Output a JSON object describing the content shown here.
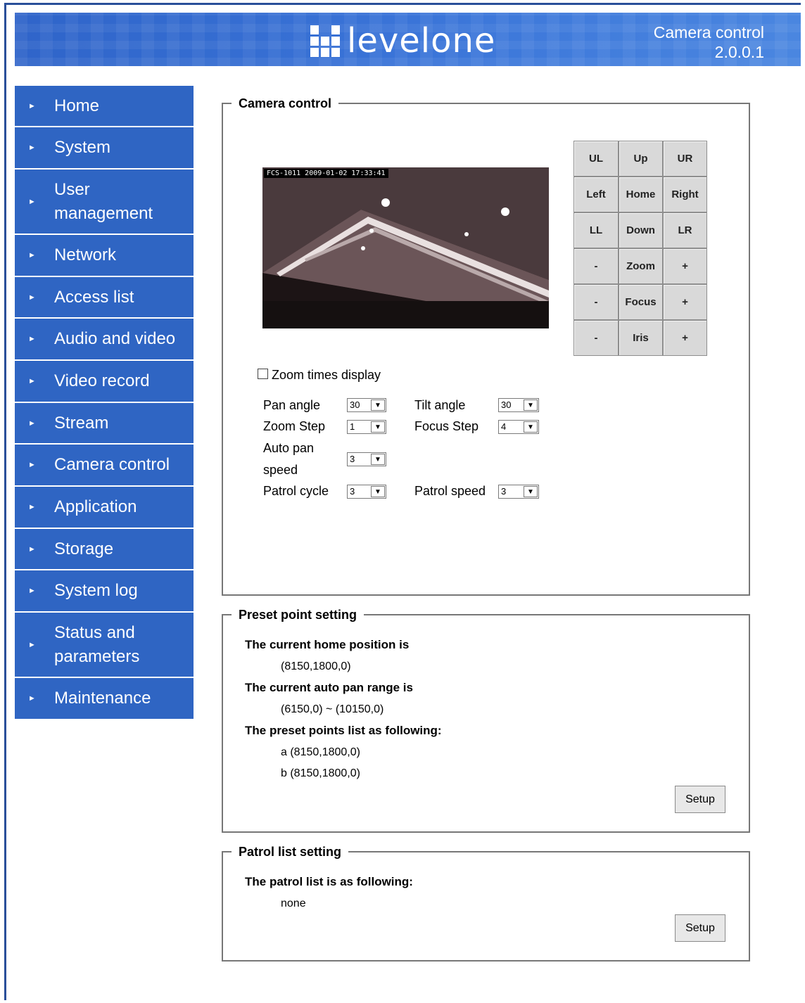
{
  "header": {
    "logo_text": "levelone",
    "page_title": "Camera control",
    "version": "2.0.0.1"
  },
  "sidebar": {
    "items": [
      {
        "label": "Home"
      },
      {
        "label": "System"
      },
      {
        "label": "User management"
      },
      {
        "label": "Network"
      },
      {
        "label": "Access list"
      },
      {
        "label": "Audio and video"
      },
      {
        "label": "Video record"
      },
      {
        "label": "Stream"
      },
      {
        "label": "Camera control"
      },
      {
        "label": "Application"
      },
      {
        "label": "Storage"
      },
      {
        "label": "System log"
      },
      {
        "label": "Status and parameters"
      },
      {
        "label": "Maintenance"
      }
    ],
    "bullet_icon": "triangle-right-icon"
  },
  "camera_control": {
    "legend": "Camera control",
    "video_timestamp": "FCS-1011 2009-01-02 17:33:41",
    "ptz": {
      "ul": "UL",
      "up": "Up",
      "ur": "UR",
      "left": "Left",
      "home": "Home",
      "right": "Right",
      "ll": "LL",
      "down": "Down",
      "lr": "LR",
      "zoom_minus": "-",
      "zoom": "Zoom",
      "zoom_plus": "+",
      "focus_minus": "-",
      "focus": "Focus",
      "focus_plus": "+",
      "iris_minus": "-",
      "iris": "Iris",
      "iris_plus": "+"
    },
    "zoom_times_display": "Zoom times display",
    "pan_angle_label": "Pan angle",
    "pan_angle_value": "30",
    "tilt_angle_label": "Tilt angle",
    "tilt_angle_value": "30",
    "zoom_step_label": "Zoom Step",
    "zoom_step_value": "1",
    "focus_step_label": "Focus Step",
    "focus_step_value": "4",
    "auto_pan_label_1": "Auto pan",
    "auto_pan_label_2": "speed",
    "auto_pan_value": "3",
    "patrol_cycle_label": "Patrol cycle",
    "patrol_cycle_value": "3",
    "patrol_speed_label": "Patrol speed",
    "patrol_speed_value": "3"
  },
  "preset": {
    "legend": "Preset point setting",
    "home_label": "The current home position is",
    "home_value": "(8150,1800,0)",
    "autopan_label": "The current auto pan range is",
    "autopan_value": "(6150,0) ~ (10150,0)",
    "list_label": "The preset points list as following:",
    "points": [
      "a (8150,1800,0)",
      "b (8150,1800,0)"
    ],
    "setup": "Setup"
  },
  "patrol": {
    "legend": "Patrol list setting",
    "list_label": "The patrol list is as following:",
    "value": "none",
    "setup": "Setup"
  },
  "colors": {
    "nav_bg": "#2f65c3",
    "banner": "#3a74d8"
  }
}
